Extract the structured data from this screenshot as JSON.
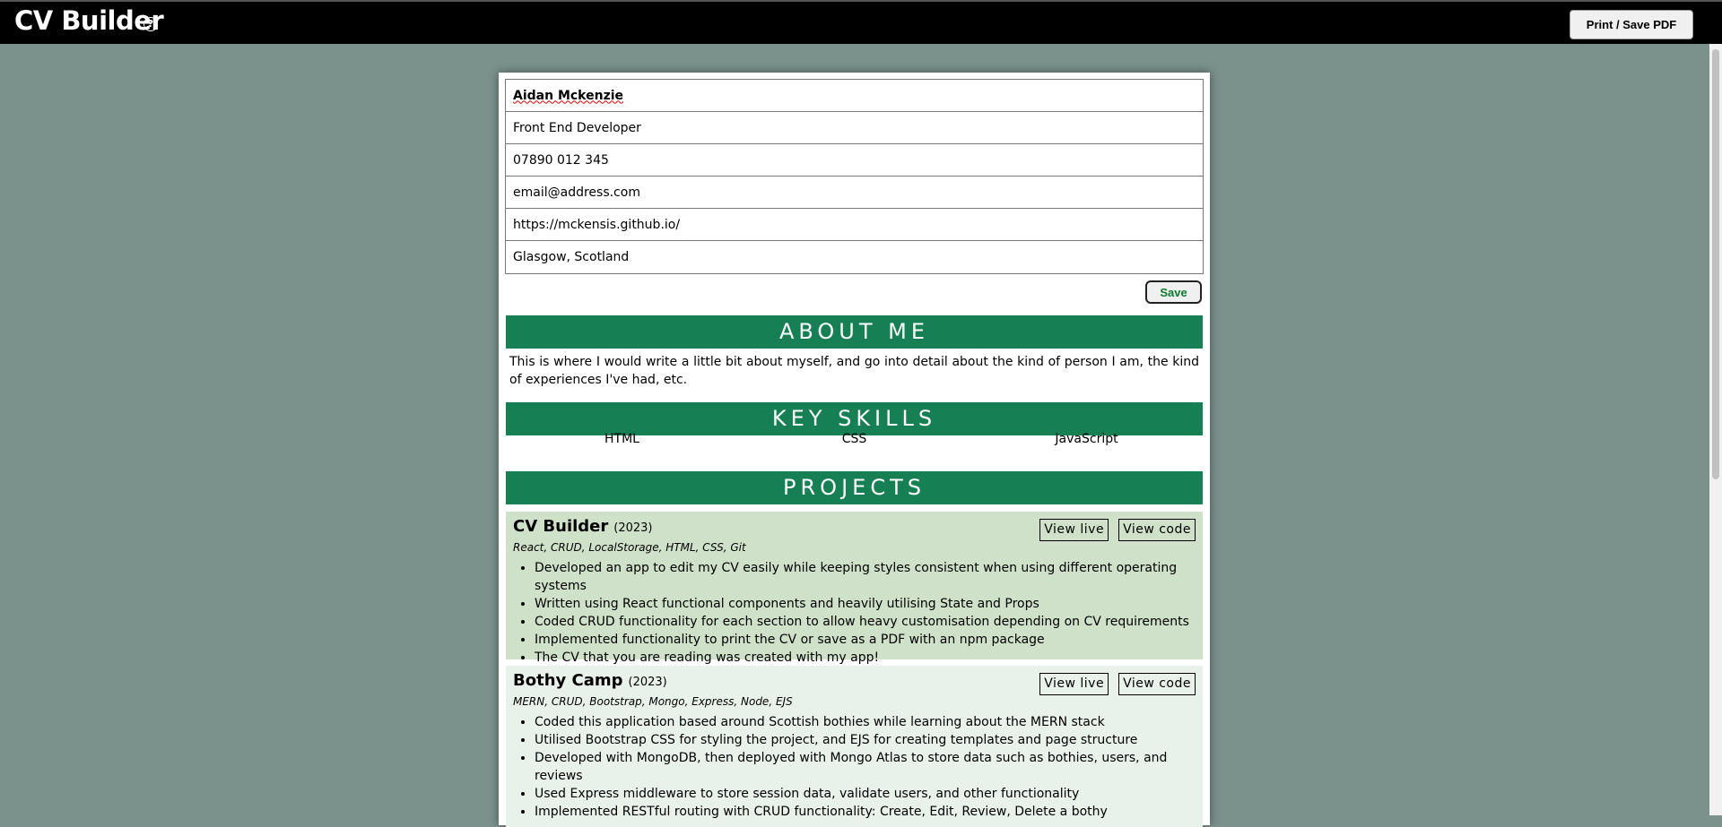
{
  "app": {
    "title": "CV Builder",
    "help_icon": "?",
    "print_label": "Print / Save PDF"
  },
  "contact": {
    "name": "Aidan Mckenzie",
    "title": "Front End Developer",
    "phone": "07890 012 345",
    "email": "email@address.com",
    "website": "https://mckensis.github.io/",
    "location": "Glasgow, Scotland",
    "save_label": "Save"
  },
  "about": {
    "heading": "ABOUT ME",
    "text": "This is where I would write a little bit about myself, and go into detail about the kind of person I am, the kind of experiences I've had, etc."
  },
  "skills": {
    "heading": "KEY SKILLS",
    "items": [
      "HTML",
      "CSS",
      "JavaScript"
    ]
  },
  "projects": {
    "heading": "PROJECTS",
    "items": [
      {
        "name": "CV Builder",
        "year": "(2023)",
        "tech": "React, CRUD, LocalStorage, HTML, CSS, Git",
        "live_label": "View live",
        "code_label": "View code",
        "bullets": [
          "Developed an app to edit my CV easily while keeping styles consistent when using different operating systems",
          "Written using React functional components and heavily utilising State and Props",
          "Coded CRUD functionality for each section to allow heavy customisation depending on CV requirements",
          "Implemented functionality to print the CV or save as a PDF with an npm package",
          "The CV that you are reading was created with my app!"
        ]
      },
      {
        "name": "Bothy Camp",
        "year": "(2023)",
        "tech": "MERN, CRUD, Bootstrap, Mongo, Express, Node, EJS",
        "live_label": "View live",
        "code_label": "View code",
        "bullets": [
          "Coded this application based around Scottish bothies while learning about the MERN stack",
          "Utilised Bootstrap CSS for styling the project, and EJS for creating templates and page structure",
          "Developed with MongoDB, then deployed with Mongo Atlas to store data such as bothies, users, and reviews",
          "Used Express middleware to store session data, validate users, and other functionality",
          "Implemented RESTful routing with CRUD functionality: Create, Edit, Review, Delete a bothy"
        ]
      }
    ]
  },
  "colors": {
    "background": "#7b918c",
    "section_header": "#168054",
    "project_1_bg": "#cfe1c9",
    "project_2_bg": "#e9f2ea",
    "save_text": "#0b7a2a"
  }
}
